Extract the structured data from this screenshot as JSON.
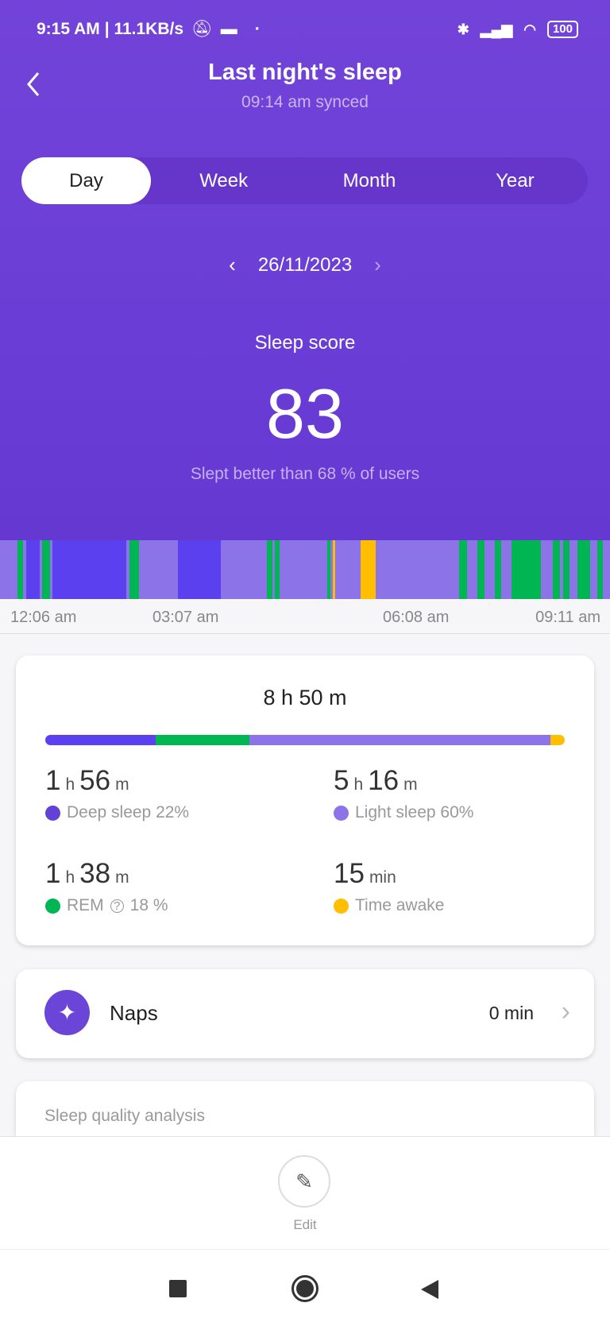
{
  "status_bar": {
    "time": "9:15 AM",
    "speed": "| 11.1KB/s",
    "battery": "100",
    "icons": [
      "bell-off-icon",
      "message-icon",
      "bluetooth-icon",
      "signal-icon",
      "wifi-icon",
      "battery-icon"
    ]
  },
  "header": {
    "title": "Last night's sleep",
    "subtitle": "09:14 am synced"
  },
  "tabs": [
    {
      "label": "Day",
      "active": true
    },
    {
      "label": "Week"
    },
    {
      "label": "Month"
    },
    {
      "label": "Year"
    }
  ],
  "date": "26/11/2023",
  "score": {
    "label": "Sleep score",
    "value": "83",
    "note": "Slept better than 68 % of users"
  },
  "colors": {
    "deep": "#5b40f0",
    "light": "#8c73e8",
    "rem": "#00b652",
    "awake": "#ffbf00",
    "header": "#7040d8"
  },
  "timeline": {
    "labels": [
      "12:06 am",
      "03:07 am",
      "06:08 am",
      "09:11 am"
    ],
    "segments_percent": [
      [
        "light",
        2.87
      ],
      [
        "rem",
        0.96
      ],
      [
        "light",
        0.51
      ],
      [
        "deep",
        2.23
      ],
      [
        "light",
        0.32
      ],
      [
        "rem",
        1.28
      ],
      [
        "light",
        0.45
      ],
      [
        "deep",
        12.12
      ],
      [
        "light",
        0.51
      ],
      [
        "rem",
        1.53
      ],
      [
        "light",
        6.38
      ],
      [
        "deep",
        7.02
      ],
      [
        "light",
        7.53
      ],
      [
        "rem",
        0.96
      ],
      [
        "light",
        0.45
      ],
      [
        "rem",
        0.7
      ],
      [
        "light",
        7.78
      ],
      [
        "rem",
        0.64
      ],
      [
        "light",
        0.38
      ],
      [
        "awake",
        0.38
      ],
      [
        "light",
        4.15
      ],
      [
        "awake",
        2.42
      ],
      [
        "light",
        13.71
      ],
      [
        "rem",
        1.28
      ],
      [
        "light",
        1.72
      ],
      [
        "rem",
        1.15
      ],
      [
        "light",
        1.72
      ],
      [
        "rem",
        1.02
      ],
      [
        "light",
        1.72
      ],
      [
        "rem",
        4.78
      ],
      [
        "light",
        2.04
      ],
      [
        "rem",
        1.15
      ],
      [
        "light",
        0.45
      ],
      [
        "rem",
        1.02
      ],
      [
        "light",
        1.4
      ],
      [
        "rem",
        2.04
      ],
      [
        "light",
        1.15
      ],
      [
        "rem",
        0.96
      ],
      [
        "light",
        1.15
      ]
    ]
  },
  "summary": {
    "total": "8 h 50 m",
    "bar_minutes": {
      "deep": 116,
      "rem": 98,
      "light": 316,
      "awake": 15
    },
    "deep": {
      "h": "1",
      "hu": "h",
      "m": "56",
      "mu": "m",
      "label": "Deep sleep 22%"
    },
    "light": {
      "h": "5",
      "hu": "h",
      "m": "16",
      "mu": "m",
      "label": "Light sleep 60%"
    },
    "rem": {
      "h": "1",
      "hu": "h",
      "m": "38",
      "mu": "m",
      "label": "REM",
      "pct": "18 %"
    },
    "awake": {
      "m": "15",
      "mu": "min",
      "label": "Time awake"
    }
  },
  "naps": {
    "label": "Naps",
    "value": "0 min"
  },
  "analysis": {
    "title": "Sleep quality analysis"
  },
  "edit": {
    "label": "Edit"
  }
}
